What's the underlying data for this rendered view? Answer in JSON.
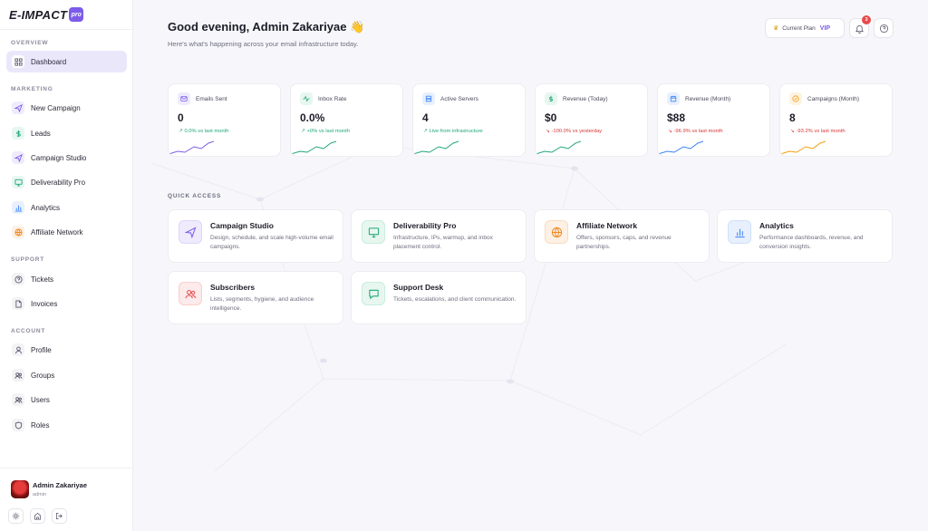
{
  "brand": {
    "name": "E-IMPACT",
    "badge": "pro"
  },
  "sidebar": {
    "sections": {
      "overview": "OVERVIEW",
      "marketing": "MARKETING",
      "support": "SUPPORT",
      "account": "ACCOUNT"
    },
    "items": {
      "dashboard": "Dashboard",
      "new_campaign": "New Campaign",
      "leads": "Leads",
      "campaign_studio": "Campaign Studio",
      "deliverability_pro": "Deliverability Pro",
      "analytics": "Analytics",
      "affiliate_network": "Affiliate Network",
      "tickets": "Tickets",
      "invoices": "Invoices",
      "profile": "Profile",
      "groups": "Groups",
      "users": "Users",
      "roles": "Roles"
    },
    "user": {
      "name": "Admin Zakariyae",
      "role": "admin"
    }
  },
  "header": {
    "greeting": "Good evening, Admin Zakariyae 👋",
    "subtitle": "Here's what's happening across your email infrastructure today.",
    "plan_label": "Current Plan",
    "plan_value": "VIP",
    "notification_count": "3"
  },
  "stats": [
    {
      "label": "Emails Sent",
      "value": "0",
      "change": "↗ 0.0% vs last month",
      "trend": "up",
      "icon": "mail-icon",
      "color": "#7c5ce8"
    },
    {
      "label": "Inbox Rate",
      "value": "0.0%",
      "change": "↗ +0% vs last month",
      "trend": "up",
      "icon": "activity-icon",
      "color": "#1fa67a"
    },
    {
      "label": "Active Servers",
      "value": "4",
      "change": "↗ Live from infrastructure",
      "trend": "up",
      "icon": "server-icon",
      "color": "#3b82f6"
    },
    {
      "label": "Revenue (Today)",
      "value": "$0",
      "change": "↘ -100.0% vs yesterday",
      "trend": "down",
      "icon": "dollar-icon",
      "color": "#1fa67a"
    },
    {
      "label": "Revenue (Month)",
      "value": "$88",
      "change": "↘ -96.9% vs last month",
      "trend": "down",
      "icon": "calendar-icon",
      "color": "#3b82f6"
    },
    {
      "label": "Campaigns (Month)",
      "value": "8",
      "change": "↘ -93.2% vs last month",
      "trend": "down",
      "icon": "target-icon",
      "color": "#f59e0b"
    }
  ],
  "quick_access": {
    "label": "QUICK ACCESS",
    "cards": [
      {
        "title": "Campaign Studio",
        "desc": "Design, schedule, and scale high-volume email campaigns.",
        "icon": "send-icon",
        "color": "#7c5ce8"
      },
      {
        "title": "Deliverability Pro",
        "desc": "Infrastructure, IPs, warmup, and inbox placement control.",
        "icon": "monitor-icon",
        "color": "#1fa67a"
      },
      {
        "title": "Affiliate Network",
        "desc": "Offers, sponsors, caps, and revenue partnerships.",
        "icon": "globe-icon",
        "color": "#f08a24"
      },
      {
        "title": "Analytics",
        "desc": "Performance dashboards, revenue, and conversion insights.",
        "icon": "bar-chart-icon",
        "color": "#3b82f6"
      },
      {
        "title": "Subscribers",
        "desc": "Lists, segments, hygiene, and audience intelligence.",
        "icon": "users-icon",
        "color": "#e84a4a"
      },
      {
        "title": "Support Desk",
        "desc": "Tickets, escalations, and client communication.",
        "icon": "chat-icon",
        "color": "#1fa67a"
      }
    ]
  }
}
